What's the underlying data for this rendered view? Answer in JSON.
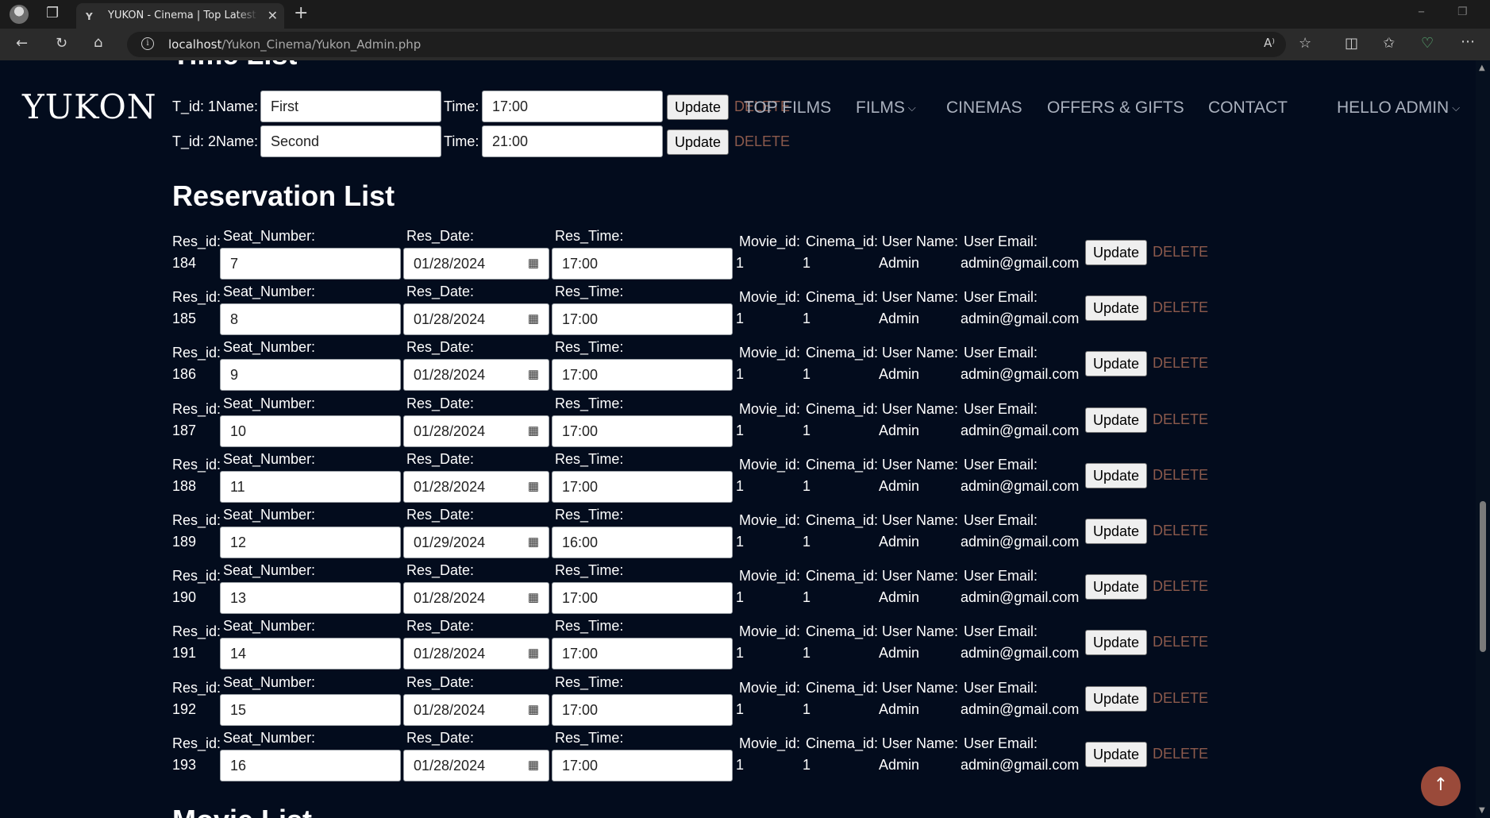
{
  "browser": {
    "tab_title": "YUKON - Cinema | Top Latest Movies",
    "tab_favicon": "Y",
    "url_host": "localhost",
    "url_path": "/Yukon_Cinema/Yukon_Admin.php"
  },
  "site": {
    "logo": "YUKON",
    "nav": {
      "top_films": "TOP FILMS",
      "films": "FILMS",
      "cinemas": "CINEMAS",
      "offers": "OFFERS & GIFTS",
      "contact": "CONTACT",
      "user": "HELLO ADMIN"
    }
  },
  "time_list": {
    "title": "Time List",
    "rows": [
      {
        "tid_label": "T_id: 1",
        "name_label": "Name:",
        "name": "First",
        "time_label": "Time:",
        "time": "17:00",
        "update": "Update",
        "delete": "DELETE"
      },
      {
        "tid_label": "T_id: 2",
        "name_label": "Name:",
        "name": "Second",
        "time_label": "Time:",
        "time": "21:00",
        "update": "Update",
        "delete": "DELETE"
      }
    ]
  },
  "reservation_list": {
    "title": "Reservation List",
    "labels": {
      "res_id": "Res_id:",
      "seat": "Seat_Number:",
      "date": "Res_Date:",
      "time": "Res_Time:",
      "movie": "Movie_id:",
      "cinema": "Cinema_id:",
      "user_name": "User Name:",
      "user_email": "User Email:",
      "update": "Update",
      "delete": "DELETE"
    },
    "rows": [
      {
        "res_id": "184",
        "seat": "7",
        "date": "01/28/2024",
        "time": "17:00",
        "movie_id": "1",
        "cinema_id": "1",
        "user_name": "Admin",
        "user_email": "admin@gmail.com"
      },
      {
        "res_id": "185",
        "seat": "8",
        "date": "01/28/2024",
        "time": "17:00",
        "movie_id": "1",
        "cinema_id": "1",
        "user_name": "Admin",
        "user_email": "admin@gmail.com"
      },
      {
        "res_id": "186",
        "seat": "9",
        "date": "01/28/2024",
        "time": "17:00",
        "movie_id": "1",
        "cinema_id": "1",
        "user_name": "Admin",
        "user_email": "admin@gmail.com"
      },
      {
        "res_id": "187",
        "seat": "10",
        "date": "01/28/2024",
        "time": "17:00",
        "movie_id": "1",
        "cinema_id": "1",
        "user_name": "Admin",
        "user_email": "admin@gmail.com"
      },
      {
        "res_id": "188",
        "seat": "11",
        "date": "01/28/2024",
        "time": "17:00",
        "movie_id": "1",
        "cinema_id": "1",
        "user_name": "Admin",
        "user_email": "admin@gmail.com"
      },
      {
        "res_id": "189",
        "seat": "12",
        "date": "01/29/2024",
        "time": "16:00",
        "movie_id": "1",
        "cinema_id": "1",
        "user_name": "Admin",
        "user_email": "admin@gmail.com"
      },
      {
        "res_id": "190",
        "seat": "13",
        "date": "01/28/2024",
        "time": "17:00",
        "movie_id": "1",
        "cinema_id": "1",
        "user_name": "Admin",
        "user_email": "admin@gmail.com"
      },
      {
        "res_id": "191",
        "seat": "14",
        "date": "01/28/2024",
        "time": "17:00",
        "movie_id": "1",
        "cinema_id": "1",
        "user_name": "Admin",
        "user_email": "admin@gmail.com"
      },
      {
        "res_id": "192",
        "seat": "15",
        "date": "01/28/2024",
        "time": "17:00",
        "movie_id": "1",
        "cinema_id": "1",
        "user_name": "Admin",
        "user_email": "admin@gmail.com"
      },
      {
        "res_id": "193",
        "seat": "16",
        "date": "01/28/2024",
        "time": "17:00",
        "movie_id": "1",
        "cinema_id": "1",
        "user_name": "Admin",
        "user_email": "admin@gmail.com"
      }
    ]
  },
  "next_section": {
    "title": "Movie List"
  },
  "colors": {
    "page_bg": "#030c1d",
    "delete": "#8c5a4c",
    "back_to_top": "#9a4a3a",
    "nav": "#a9b0bd"
  },
  "icons": [
    "back-icon",
    "refresh-icon",
    "home-icon",
    "info-icon",
    "read-aloud-icon",
    "favorite-star-icon",
    "split-screen-icon",
    "favorites-icon",
    "browser-essentials-icon",
    "more-icon",
    "calendar-icon",
    "arrow-up-icon"
  ]
}
